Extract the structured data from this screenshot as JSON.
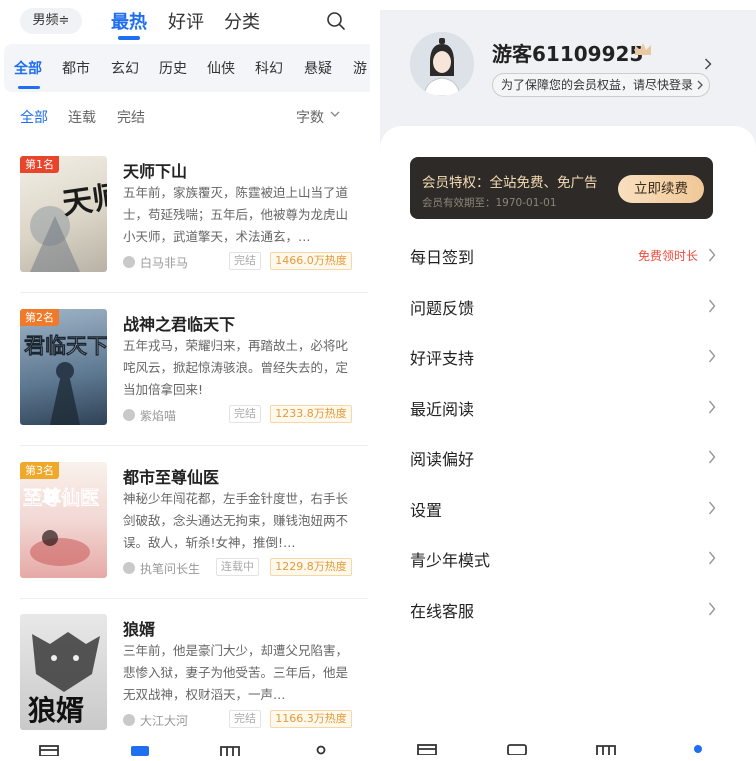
{
  "left": {
    "gender_switch": "男频≑",
    "top_tabs": [
      {
        "label": "最热",
        "active": true
      },
      {
        "label": "好评",
        "active": false
      },
      {
        "label": "分类",
        "active": false
      }
    ],
    "categories": [
      "全部",
      "都市",
      "玄幻",
      "历史",
      "仙侠",
      "科幻",
      "悬疑",
      "游"
    ],
    "filters": [
      "全部",
      "连载",
      "完结"
    ],
    "sort_label": "字数",
    "books": [
      {
        "rank": "第1名",
        "title": "天师下山",
        "desc": "五年前，家族覆灭，陈霆被迫上山当了道士，苟延残喘；五年后，他被尊为龙虎山小天师，武道擎天，术法通玄，…",
        "author": "白马非马",
        "status": "完结",
        "heat": "1466.0万热度",
        "cover_text": "天师下山"
      },
      {
        "rank": "第2名",
        "title": "战神之君临天下",
        "desc": "五年戎马，荣耀归来，再踏故土，必将叱咤风云，掀起惊涛骇浪。曾经失去的，定当加倍拿回来!",
        "author": "紫焰喵",
        "status": "完结",
        "heat": "1233.8万热度",
        "cover_text": "君临天下"
      },
      {
        "rank": "第3名",
        "title": "都市至尊仙医",
        "desc": "神秘少年闯花都，左手金针度世，右手长剑破敌，念头通达无拘束，赚钱泡妞两不误。敌人，斩杀!女神，推倒!…",
        "author": "执笔问长生",
        "status": "连载中",
        "heat": "1229.8万热度",
        "cover_text": "至尊仙医"
      },
      {
        "rank": "",
        "title": "狼婿",
        "desc": "三年前，他是豪门大少，却遭父兄陷害，悲惨入狱，妻子为他受苦。三年后，他是无双战神，权财滔天，一声…",
        "author": "大江大河",
        "status": "完结",
        "heat": "1166.3万热度",
        "cover_text": "狼婿"
      }
    ]
  },
  "right": {
    "username": "游客61109925",
    "login_hint": "为了保障您的会员权益，请尽快登录",
    "vip": {
      "title": "会员特权：全站免费、免广告",
      "expire": "会员有效期至：1970-01-01",
      "renew_button": "立即续费"
    },
    "menu": [
      {
        "label": "每日签到",
        "extra": "免费领时长"
      },
      {
        "label": "问题反馈",
        "extra": ""
      },
      {
        "label": "好评支持",
        "extra": ""
      },
      {
        "label": "最近阅读",
        "extra": ""
      },
      {
        "label": "阅读偏好",
        "extra": ""
      },
      {
        "label": "设置",
        "extra": ""
      },
      {
        "label": "青少年模式",
        "extra": ""
      },
      {
        "label": "在线客服",
        "extra": ""
      }
    ]
  },
  "colors": {
    "accent": "#1f6ff0",
    "rank1": "#e8452c",
    "rank2": "#f07a2a",
    "rank3": "#f0a82a",
    "vip_bg": "#2d2a28",
    "vip_text": "#f5dcb4",
    "heat": "#e39b3b",
    "extra_red": "#ef4a3a"
  }
}
